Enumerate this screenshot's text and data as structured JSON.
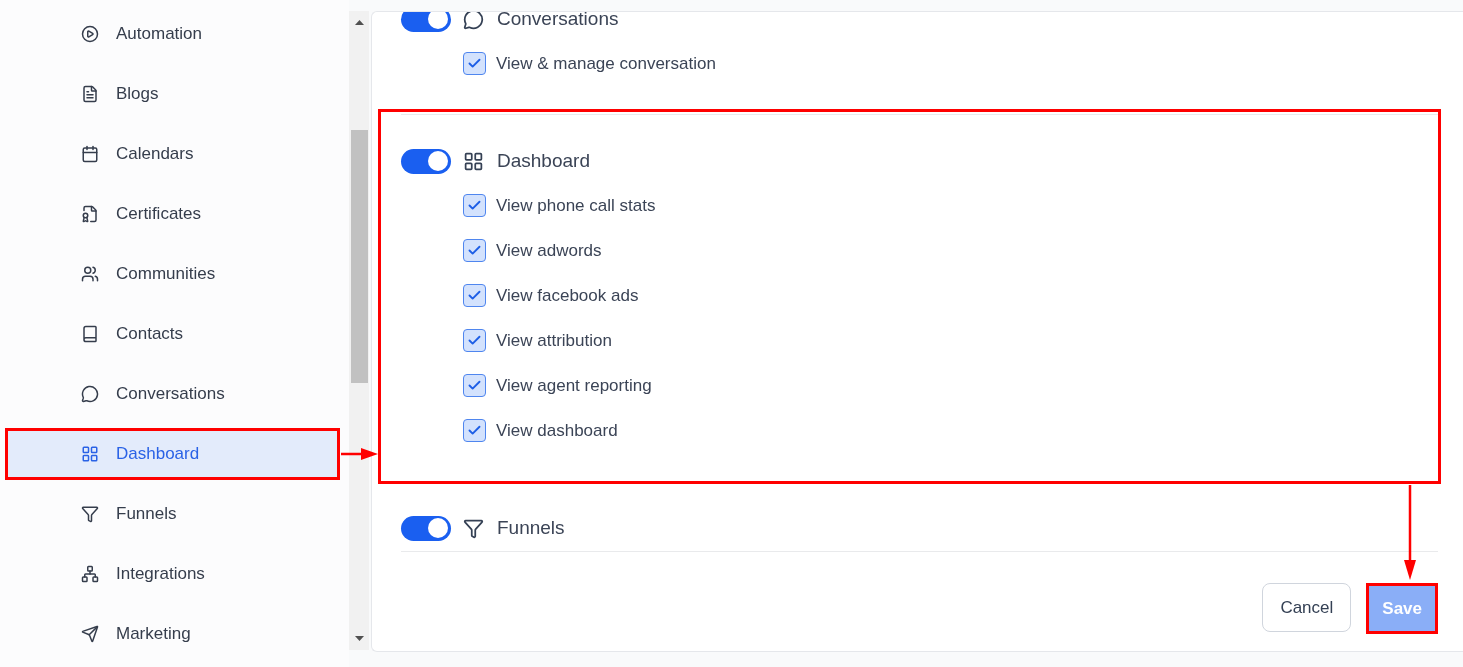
{
  "sidebar": {
    "items": [
      {
        "label": "Automation",
        "selected": false,
        "highlighted": false
      },
      {
        "label": "Blogs",
        "selected": false,
        "highlighted": false
      },
      {
        "label": "Calendars",
        "selected": false,
        "highlighted": false
      },
      {
        "label": "Certificates",
        "selected": false,
        "highlighted": false
      },
      {
        "label": "Communities",
        "selected": false,
        "highlighted": false
      },
      {
        "label": "Contacts",
        "selected": false,
        "highlighted": false
      },
      {
        "label": "Conversations",
        "selected": false,
        "highlighted": false
      },
      {
        "label": "Dashboard",
        "selected": true,
        "highlighted": true
      },
      {
        "label": "Funnels",
        "selected": false,
        "highlighted": false
      },
      {
        "label": "Integrations",
        "selected": false,
        "highlighted": false
      },
      {
        "label": "Marketing",
        "selected": false,
        "highlighted": false
      }
    ]
  },
  "permissions": [
    {
      "title": "Conversations",
      "enabled": true,
      "highlighted": false,
      "items": [
        {
          "label": "View & manage conversation",
          "checked": true
        }
      ]
    },
    {
      "title": "Dashboard",
      "enabled": true,
      "highlighted": true,
      "items": [
        {
          "label": "View phone call stats",
          "checked": true
        },
        {
          "label": "View adwords",
          "checked": true
        },
        {
          "label": "View facebook ads",
          "checked": true
        },
        {
          "label": "View attribution",
          "checked": true
        },
        {
          "label": "View agent reporting",
          "checked": true
        },
        {
          "label": "View dashboard",
          "checked": true
        }
      ]
    },
    {
      "title": "Funnels",
      "enabled": true,
      "highlighted": false
    }
  ],
  "footer": {
    "buttons": [
      {
        "label": "Cancel",
        "kind": "secondary",
        "disabled": false,
        "highlighted": false
      },
      {
        "label": "Save",
        "kind": "primary",
        "disabled": true,
        "highlighted": true
      }
    ]
  }
}
